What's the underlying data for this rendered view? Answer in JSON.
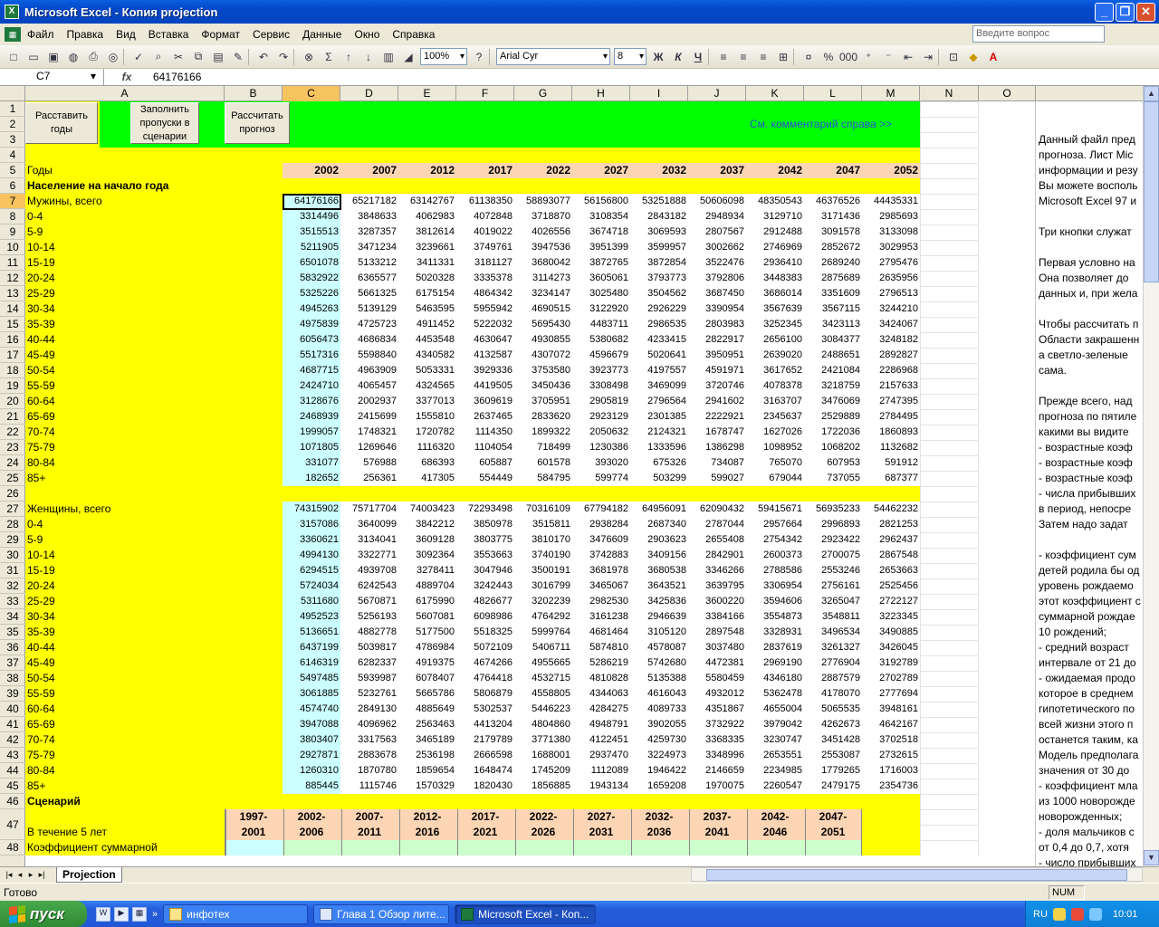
{
  "window": {
    "title": "Microsoft Excel - Копия projection",
    "app_icon": "X"
  },
  "menu": [
    "Файл",
    "Правка",
    "Вид",
    "Вставка",
    "Формат",
    "Сервис",
    "Данные",
    "Окно",
    "Справка"
  ],
  "ask_placeholder": "Введите вопрос",
  "toolbar": {
    "zoom": "100%",
    "font": "Arial Cyr",
    "size": "8",
    "bold": "Ж",
    "italic": "К",
    "underline": "Ч",
    "percent": "%",
    "thousands": "000",
    "sigma": "Σ"
  },
  "formula": {
    "cell_ref": "C7",
    "fx": "fx",
    "value": "64176166"
  },
  "columns": [
    "A",
    "B",
    "C",
    "D",
    "E",
    "F",
    "G",
    "H",
    "I",
    "J",
    "K",
    "L",
    "M",
    "N",
    "O"
  ],
  "rows": [
    "1",
    "2",
    "3",
    "4",
    "5",
    "6",
    "7",
    "8",
    "9",
    "10",
    "11",
    "12",
    "13",
    "14",
    "15",
    "16",
    "17",
    "18",
    "19",
    "20",
    "21",
    "22",
    "23",
    "24",
    "25",
    "26",
    "27",
    "28",
    "29",
    "30",
    "31",
    "32",
    "33",
    "34",
    "35",
    "36",
    "37",
    "38",
    "39",
    "40",
    "41",
    "42",
    "43",
    "44",
    "45",
    "46",
    "47",
    "48"
  ],
  "buttons": {
    "arrange_years": "Расставить годы",
    "fill_gaps": "Заполнить пропуски в сценарии",
    "compute_forecast": "Рассчитать прогноз"
  },
  "see_comment": "См. комментарий справа >>",
  "labels": {
    "years": "Годы",
    "population": "Население на начало года",
    "men_total": "Мужины, всего",
    "women_total": "Женщины, всего",
    "scenario": "Сценарий",
    "within_5": "В течение 5 лет",
    "tfr": "Коэффициент суммарной"
  },
  "years": [
    "2002",
    "2007",
    "2012",
    "2017",
    "2022",
    "2027",
    "2032",
    "2037",
    "2042",
    "2047",
    "2052"
  ],
  "age_groups": [
    "0-4",
    "5-9",
    "10-14",
    "15-19",
    "20-24",
    "25-29",
    "30-34",
    "35-39",
    "40-44",
    "45-49",
    "50-54",
    "55-59",
    "60-64",
    "65-69",
    "70-74",
    "75-79",
    "80-84",
    "85+"
  ],
  "men_total_values": [
    "64176166",
    "65217182",
    "63142767",
    "61138350",
    "58893077",
    "56156800",
    "53251888",
    "50606098",
    "48350543",
    "46376526",
    "44435331"
  ],
  "men": [
    [
      "3314496",
      "3848633",
      "4062983",
      "4072848",
      "3718870",
      "3108354",
      "2843182",
      "2948934",
      "3129710",
      "3171436",
      "2985693"
    ],
    [
      "3515513",
      "3287357",
      "3812614",
      "4019022",
      "4026556",
      "3674718",
      "3069593",
      "2807567",
      "2912488",
      "3091578",
      "3133098"
    ],
    [
      "5211905",
      "3471234",
      "3239661",
      "3749761",
      "3947536",
      "3951399",
      "3599957",
      "3002662",
      "2746969",
      "2852672",
      "3029953"
    ],
    [
      "6501078",
      "5133212",
      "3411331",
      "3181127",
      "3680042",
      "3872765",
      "3872854",
      "3522476",
      "2936410",
      "2689240",
      "2795476"
    ],
    [
      "5832922",
      "6365577",
      "5020328",
      "3335378",
      "3114273",
      "3605061",
      "3793773",
      "3792806",
      "3448383",
      "2875689",
      "2635956"
    ],
    [
      "5325226",
      "5661325",
      "6175154",
      "4864342",
      "3234147",
      "3025480",
      "3504562",
      "3687450",
      "3686014",
      "3351609",
      "2796513"
    ],
    [
      "4945263",
      "5139129",
      "5463595",
      "5955942",
      "4690515",
      "3122920",
      "2926229",
      "3390954",
      "3567639",
      "3567115",
      "3244210"
    ],
    [
      "4975839",
      "4725723",
      "4911452",
      "5222032",
      "5695430",
      "4483711",
      "2986535",
      "2803983",
      "3252345",
      "3423113",
      "3424067"
    ],
    [
      "6056473",
      "4686834",
      "4453548",
      "4630647",
      "4930855",
      "5380682",
      "4233415",
      "2822917",
      "2656100",
      "3084377",
      "3248182"
    ],
    [
      "5517316",
      "5598840",
      "4340582",
      "4132587",
      "4307072",
      "4596679",
      "5020641",
      "3950951",
      "2639020",
      "2488651",
      "2892827"
    ],
    [
      "4687715",
      "4963909",
      "5053331",
      "3929336",
      "3753580",
      "3923773",
      "4197557",
      "4591971",
      "3617652",
      "2421084",
      "2286968"
    ],
    [
      "2424710",
      "4065457",
      "4324565",
      "4419505",
      "3450436",
      "3308498",
      "3469099",
      "3720746",
      "4078378",
      "3218759",
      "2157633"
    ],
    [
      "3128676",
      "2002937",
      "3377013",
      "3609619",
      "3705951",
      "2905819",
      "2796564",
      "2941602",
      "3163707",
      "3476069",
      "2747395"
    ],
    [
      "2468939",
      "2415699",
      "1555810",
      "2637465",
      "2833620",
      "2923129",
      "2301385",
      "2222921",
      "2345637",
      "2529889",
      "2784495"
    ],
    [
      "1999057",
      "1748321",
      "1720782",
      "1114350",
      "1899322",
      "2050632",
      "2124321",
      "1678747",
      "1627026",
      "1722036",
      "1860893"
    ],
    [
      "1071805",
      "1269646",
      "1116320",
      "1104054",
      "718499",
      "1230386",
      "1333596",
      "1386298",
      "1098952",
      "1068202",
      "1132682"
    ],
    [
      "331077",
      "576988",
      "686393",
      "605887",
      "601578",
      "393020",
      "675326",
      "734087",
      "765070",
      "607953",
      "591912"
    ],
    [
      "182652",
      "256361",
      "417305",
      "554449",
      "584795",
      "599774",
      "503299",
      "599027",
      "679044",
      "737055",
      "687377"
    ]
  ],
  "women_total_values": [
    "74315902",
    "75717704",
    "74003423",
    "72293498",
    "70316109",
    "67794182",
    "64956091",
    "62090432",
    "59415671",
    "56935233",
    "54462232"
  ],
  "women": [
    [
      "3157086",
      "3640099",
      "3842212",
      "3850978",
      "3515811",
      "2938284",
      "2687340",
      "2787044",
      "2957664",
      "2996893",
      "2821253"
    ],
    [
      "3360621",
      "3134041",
      "3609128",
      "3803775",
      "3810170",
      "3476609",
      "2903623",
      "2655408",
      "2754342",
      "2923422",
      "2962437"
    ],
    [
      "4994130",
      "3322771",
      "3092364",
      "3553663",
      "3740190",
      "3742883",
      "3409156",
      "2842901",
      "2600373",
      "2700075",
      "2867548"
    ],
    [
      "6294515",
      "4939708",
      "3278411",
      "3047946",
      "3500191",
      "3681978",
      "3680538",
      "3346266",
      "2788586",
      "2553246",
      "2653663"
    ],
    [
      "5724034",
      "6242543",
      "4889704",
      "3242443",
      "3016799",
      "3465067",
      "3643521",
      "3639795",
      "3306954",
      "2756161",
      "2525456"
    ],
    [
      "5311680",
      "5670871",
      "6175990",
      "4826677",
      "3202239",
      "2982530",
      "3425836",
      "3600220",
      "3594606",
      "3265047",
      "2722127"
    ],
    [
      "4952523",
      "5256193",
      "5607081",
      "6098986",
      "4764292",
      "3161238",
      "2946639",
      "3384166",
      "3554873",
      "3548811",
      "3223345"
    ],
    [
      "5136651",
      "4882778",
      "5177500",
      "5518325",
      "5999764",
      "4681464",
      "3105120",
      "2897548",
      "3328931",
      "3496534",
      "3490885"
    ],
    [
      "6437199",
      "5039817",
      "4786984",
      "5072109",
      "5406711",
      "5874810",
      "4578087",
      "3037480",
      "2837619",
      "3261327",
      "3426045"
    ],
    [
      "6146319",
      "6282337",
      "4919375",
      "4674266",
      "4955665",
      "5286219",
      "5742680",
      "4472381",
      "2969190",
      "2776904",
      "3192789"
    ],
    [
      "5497485",
      "5939987",
      "6078407",
      "4764418",
      "4532715",
      "4810828",
      "5135388",
      "5580459",
      "4346180",
      "2887579",
      "2702789"
    ],
    [
      "3061885",
      "5232761",
      "5665786",
      "5806879",
      "4558805",
      "4344063",
      "4616043",
      "4932012",
      "5362478",
      "4178070",
      "2777694"
    ],
    [
      "4574740",
      "2849130",
      "4885649",
      "5302537",
      "5446223",
      "4284275",
      "4089733",
      "4351867",
      "4655004",
      "5065535",
      "3948161"
    ],
    [
      "3947088",
      "4096962",
      "2563463",
      "4413204",
      "4804860",
      "4948791",
      "3902055",
      "3732922",
      "3979042",
      "4262673",
      "4642167"
    ],
    [
      "3803407",
      "3317563",
      "3465189",
      "2179789",
      "3771380",
      "4122451",
      "4259730",
      "3368335",
      "3230747",
      "3451428",
      "3702518"
    ],
    [
      "2927871",
      "2883678",
      "2536198",
      "2666598",
      "1688001",
      "2937470",
      "3224973",
      "3348996",
      "2653551",
      "2553087",
      "2732615"
    ],
    [
      "1260310",
      "1870780",
      "1859654",
      "1648474",
      "1745209",
      "1112089",
      "1946422",
      "2146659",
      "2234985",
      "1779265",
      "1716003"
    ],
    [
      "885445",
      "1115746",
      "1570329",
      "1820430",
      "1856885",
      "1943134",
      "1659208",
      "1970075",
      "2260547",
      "2479175",
      "2354736"
    ]
  ],
  "periods": [
    [
      "1997-",
      "2001"
    ],
    [
      "2002-",
      "2006"
    ],
    [
      "2007-",
      "2011"
    ],
    [
      "2012-",
      "2016"
    ],
    [
      "2017-",
      "2021"
    ],
    [
      "2022-",
      "2026"
    ],
    [
      "2027-",
      "2031"
    ],
    [
      "2032-",
      "2036"
    ],
    [
      "2037-",
      "2041"
    ],
    [
      "2042-",
      "2046"
    ],
    [
      "2047-",
      "2051"
    ]
  ],
  "comment_lines": [
    {
      "r": 2,
      "t": "Данный файл пред"
    },
    {
      "r": 3,
      "t": "прогноза. Лист Mic"
    },
    {
      "r": 4,
      "t": "информации и резу"
    },
    {
      "r": 5,
      "t": "Вы можете восполь"
    },
    {
      "r": 6,
      "t": "Microsoft Excel 97 и"
    },
    {
      "r": 8,
      "t": "Три кнопки служат"
    },
    {
      "r": 10,
      "t": "Первая условно на"
    },
    {
      "r": 11,
      "t": "Она  позволяет до"
    },
    {
      "r": 12,
      "t": "данных и, при жела"
    },
    {
      "r": 14,
      "t": "Чтобы рассчитать п"
    },
    {
      "r": 15,
      "t": "Области закрашенн"
    },
    {
      "r": 16,
      "t": " а светло-зеленые"
    },
    {
      "r": 17,
      "t": "сама."
    },
    {
      "r": 19,
      "t": "Прежде всего, над"
    },
    {
      "r": 20,
      "t": "прогноза по пятиле"
    },
    {
      "r": 21,
      "t": "какими вы видите"
    },
    {
      "r": 22,
      "t": "- возрастные коэф"
    },
    {
      "r": 23,
      "t": "- возрастные коэф"
    },
    {
      "r": 24,
      "t": "- возрастные коэф"
    },
    {
      "r": 25,
      "t": "- числа прибывших"
    },
    {
      "r": 26,
      "t": " в период, непосре"
    },
    {
      "r": 27,
      "t": " Затем надо задат"
    },
    {
      "r": 29,
      "t": "- коэффициент сум"
    },
    {
      "r": 30,
      "t": "детей родила бы од"
    },
    {
      "r": 31,
      "t": " уровень рождаемо"
    },
    {
      "r": 32,
      "t": "этот коэффициент с"
    },
    {
      "r": 33,
      "t": "суммарной рождае"
    },
    {
      "r": 34,
      "t": "10 рождений;"
    },
    {
      "r": 35,
      "t": "- средний возраст"
    },
    {
      "r": 36,
      "t": "интервале от 21 до"
    },
    {
      "r": 37,
      "t": "- ожидаемая продо"
    },
    {
      "r": 38,
      "t": "которое в среднем"
    },
    {
      "r": 39,
      "t": "гипотетического по"
    },
    {
      "r": 40,
      "t": "всей жизни этого п"
    },
    {
      "r": 41,
      "t": "останется таким, ка"
    },
    {
      "r": 42,
      "t": "Модель предполага"
    },
    {
      "r": 43,
      "t": "значения от 30 до"
    },
    {
      "r": 44,
      "t": "- коэффициент мла"
    },
    {
      "r": 45,
      "t": "из 1000 новорожде"
    },
    {
      "r": 46,
      "t": "новорожденных;"
    },
    {
      "r": 48,
      "t": "- доля мальчиков с"
    },
    {
      "r": 49,
      "t": "от 0,4 до 0,7, хотя"
    },
    {
      "r": 50,
      "t": "- число прибывших"
    }
  ],
  "sheet_tab": "Projection",
  "status": {
    "ready": "Готово",
    "num": "NUM"
  },
  "taskbar": {
    "start": "пуск",
    "tasks": [
      "инфотех",
      "Глава 1 Обзор лите...",
      "Microsoft Excel - Коп..."
    ],
    "lang": "RU",
    "time": "10:01"
  },
  "colors": {
    "yellow": "#ffff00",
    "green": "#00ff00",
    "peach": "#fcd5b4",
    "light_cyan": "#ccffff",
    "light_green": "#ccffcc"
  }
}
